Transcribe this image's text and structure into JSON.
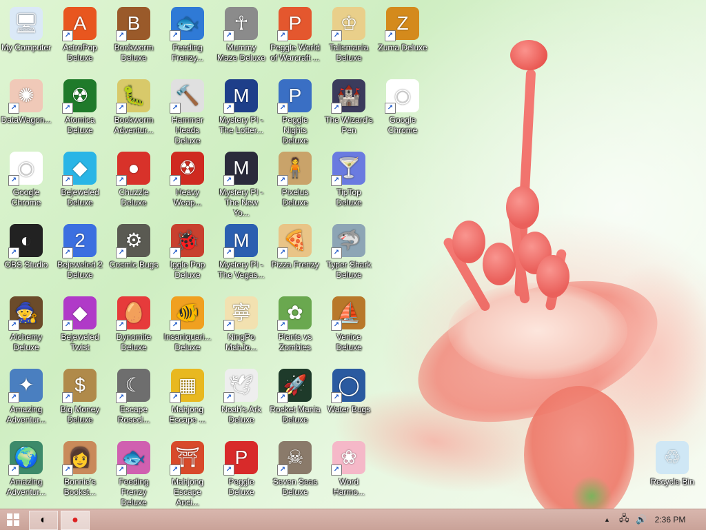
{
  "desktop": {
    "icons": [
      {
        "label": "My Computer",
        "icon": "computer-icon",
        "glyph": "🖥",
        "bg": "#dbe9f7",
        "shortcut": false
      },
      {
        "label": "AstroPop Deluxe",
        "icon": "astropop-icon",
        "glyph": "A",
        "bg": "#e8561f",
        "shortcut": true
      },
      {
        "label": "Bookworm Deluxe",
        "icon": "bookworm-icon",
        "glyph": "B",
        "bg": "#9a5a2a",
        "shortcut": true
      },
      {
        "label": "Feeding Frenzy...",
        "icon": "feeding-frenzy-icon",
        "glyph": "🐟",
        "bg": "#2f7ad6",
        "shortcut": true
      },
      {
        "label": "Mummy Maze Deluxe",
        "icon": "mummy-maze-icon",
        "glyph": "☥",
        "bg": "#8b8b8b",
        "shortcut": true
      },
      {
        "label": "Peggle World of Warcraft ...",
        "icon": "peggle-wow-icon",
        "glyph": "P",
        "bg": "#e4572e",
        "shortcut": true
      },
      {
        "label": "Talismania Deluxe",
        "icon": "talismania-icon",
        "glyph": "♔",
        "bg": "#e9cf8a",
        "shortcut": true
      },
      {
        "label": "Zuma Deluxe",
        "icon": "zuma-icon",
        "glyph": "Z",
        "bg": "#d48a1c",
        "shortcut": true
      },
      {
        "label": "DataWagon...",
        "icon": "datawagon-icon",
        "glyph": "✺",
        "bg": "#f0c9b8",
        "shortcut": true
      },
      {
        "label": "Atomica Deluxe",
        "icon": "atomica-icon",
        "glyph": "☢",
        "bg": "#1f7a2a",
        "shortcut": true
      },
      {
        "label": "Bookworm Adventur...",
        "icon": "bookworm-adventures-icon",
        "glyph": "🐛",
        "bg": "#d8c96a",
        "shortcut": true
      },
      {
        "label": "Hammer Heads Deluxe",
        "icon": "hammer-heads-icon",
        "glyph": "🔨",
        "bg": "#e0e0e0",
        "shortcut": true
      },
      {
        "label": "Mystery PI - The Lotter...",
        "icon": "mystery-pi-lottery-icon",
        "glyph": "M",
        "bg": "#1e3f8a",
        "shortcut": true
      },
      {
        "label": "Peggle Nights Deluxe",
        "icon": "peggle-nights-icon",
        "glyph": "P",
        "bg": "#3a6fc4",
        "shortcut": true
      },
      {
        "label": "The Wizard's Pen",
        "icon": "wizards-pen-icon",
        "glyph": "🏰",
        "bg": "#3b3b5c",
        "shortcut": true
      },
      {
        "label": "Google Chrome",
        "icon": "chrome-icon",
        "glyph": "◉",
        "bg": "#ffffff",
        "shortcut": true
      },
      {
        "label": "Google Chrome",
        "icon": "chrome-icon",
        "glyph": "◉",
        "bg": "#ffffff",
        "shortcut": true
      },
      {
        "label": "Bejeweled Deluxe",
        "icon": "bejeweled-icon",
        "glyph": "◆",
        "bg": "#2ab5e6",
        "shortcut": true
      },
      {
        "label": "Chuzzle Deluxe",
        "icon": "chuzzle-icon",
        "glyph": "●",
        "bg": "#d8322a",
        "shortcut": true
      },
      {
        "label": "Heavy Weap...",
        "icon": "heavy-weapon-icon",
        "glyph": "☢",
        "bg": "#cf2a20",
        "shortcut": true
      },
      {
        "label": "Mystery PI - The New Yo...",
        "icon": "mystery-pi-newyork-icon",
        "glyph": "M",
        "bg": "#2b2b3b",
        "shortcut": true
      },
      {
        "label": "Pixelus Deluxe",
        "icon": "pixelus-icon",
        "glyph": "🧍",
        "bg": "#c9a36a",
        "shortcut": true
      },
      {
        "label": "TipTop Deluxe",
        "icon": "tiptop-icon",
        "glyph": "🍸",
        "bg": "#6a7be0",
        "shortcut": true
      },
      {
        "label": "OBS Studio",
        "icon": "obs-icon",
        "glyph": "◐",
        "bg": "#222222",
        "shortcut": true
      },
      {
        "label": "Bejeweled 2 Deluxe",
        "icon": "bejeweled2-icon",
        "glyph": "2",
        "bg": "#3b6fe0",
        "shortcut": true
      },
      {
        "label": "Cosmic Bugs",
        "icon": "cosmic-bugs-icon",
        "glyph": "⚙",
        "bg": "#5a5a52",
        "shortcut": true
      },
      {
        "label": "Iggle Pop Deluxe",
        "icon": "iggle-pop-icon",
        "glyph": "🐞",
        "bg": "#c8402e",
        "shortcut": true
      },
      {
        "label": "Mystery PI - The Vegas...",
        "icon": "mystery-pi-vegas-icon",
        "glyph": "M",
        "bg": "#2b5fb0",
        "shortcut": true
      },
      {
        "label": "Pizza Frenzy",
        "icon": "pizza-frenzy-icon",
        "glyph": "🍕",
        "bg": "#e9c487",
        "shortcut": true
      },
      {
        "label": "Typer Shark Deluxe",
        "icon": "typer-shark-icon",
        "glyph": "🦈",
        "bg": "#8da5b5",
        "shortcut": true
      },
      {
        "label": "Alchemy Deluxe",
        "icon": "alchemy-icon",
        "glyph": "🧙",
        "bg": "#6b4b2a",
        "shortcut": true
      },
      {
        "label": "Bejeweled Twist",
        "icon": "bejeweled-twist-icon",
        "glyph": "◆",
        "bg": "#b03ac8",
        "shortcut": true
      },
      {
        "label": "Dynomite Deluxe",
        "icon": "dynomite-icon",
        "glyph": "🥚",
        "bg": "#e63b3b",
        "shortcut": true
      },
      {
        "label": "Insaniquari... Deluxe",
        "icon": "insaniquarium-icon",
        "glyph": "🐠",
        "bg": "#f0a020",
        "shortcut": true
      },
      {
        "label": "NingPo MahJo...",
        "icon": "ningpo-mahjong-icon",
        "glyph": "寧",
        "bg": "#f2e1b0",
        "shortcut": true
      },
      {
        "label": "Plants vs Zombies",
        "icon": "plants-vs-zombies-icon",
        "glyph": "✿",
        "bg": "#6aa84f",
        "shortcut": true
      },
      {
        "label": "Venice Deluxe",
        "icon": "venice-icon",
        "glyph": "⛵",
        "bg": "#b8782a",
        "shortcut": true
      },
      {
        "label": "Amazing Adventur...",
        "icon": "amazing-adventures-icon",
        "glyph": "✦",
        "bg": "#4a7fc0",
        "shortcut": true
      },
      {
        "label": "Big Money Deluxe",
        "icon": "big-money-icon",
        "glyph": "$",
        "bg": "#b08a4a",
        "shortcut": true
      },
      {
        "label": "Escape Rosecl...",
        "icon": "escape-rosecliff-icon",
        "glyph": "☾",
        "bg": "#6e6e6e",
        "shortcut": true
      },
      {
        "label": "Mahjong Escape ...",
        "icon": "mahjong-escape-icon",
        "glyph": "▦",
        "bg": "#e8b820",
        "shortcut": true
      },
      {
        "label": "Noah's Ark Deluxe",
        "icon": "noahs-ark-icon",
        "glyph": "🕊",
        "bg": "#eeeeee",
        "shortcut": true
      },
      {
        "label": "Rocket Mania Deluxe",
        "icon": "rocket-mania-icon",
        "glyph": "🚀",
        "bg": "#1e3a2a",
        "shortcut": true
      },
      {
        "label": "Water Bugs",
        "icon": "water-bugs-icon",
        "glyph": "◯",
        "bg": "#2a5aa0",
        "shortcut": true
      },
      {
        "label": "Amazing Adventur...",
        "icon": "amazing-adventures-icon",
        "glyph": "🌍",
        "bg": "#3d8a6a",
        "shortcut": true
      },
      {
        "label": "Bonnie's Bookst...",
        "icon": "bonnies-bookstore-icon",
        "glyph": "👩",
        "bg": "#c98a5a",
        "shortcut": true
      },
      {
        "label": "Feeding Frenzy Deluxe",
        "icon": "feeding-frenzy-deluxe-icon",
        "glyph": "🐟",
        "bg": "#d060b0",
        "shortcut": true
      },
      {
        "label": "Mahjong Escape Anci...",
        "icon": "mahjong-escape-ancient-icon",
        "glyph": "⛩",
        "bg": "#d84a2a",
        "shortcut": true
      },
      {
        "label": "Peggle Deluxe",
        "icon": "peggle-icon",
        "glyph": "P",
        "bg": "#d82a2a",
        "shortcut": true
      },
      {
        "label": "Seven Seas Deluxe",
        "icon": "seven-seas-icon",
        "glyph": "☠",
        "bg": "#8a7a6a",
        "shortcut": true
      },
      {
        "label": "Word Harmo...",
        "icon": "word-harmony-icon",
        "glyph": "❀",
        "bg": "#f5b8c8",
        "shortcut": true
      },
      {
        "label": "Recycle Bin",
        "icon": "recycle-bin-icon",
        "glyph": "♲",
        "bg": "#cfe7f5",
        "shortcut": false
      }
    ]
  },
  "taskbar": {
    "start_icon": "windows-start-icon",
    "items": [
      {
        "name": "obs-studio-task",
        "icon": "obs-icon",
        "glyph": "◐"
      },
      {
        "name": "dynomite-task",
        "icon": "dynomite-icon",
        "glyph": "●"
      }
    ],
    "tray": {
      "overflow": "▲",
      "network": "🖧",
      "volume": "🔊",
      "clock": "2:36 PM"
    }
  }
}
